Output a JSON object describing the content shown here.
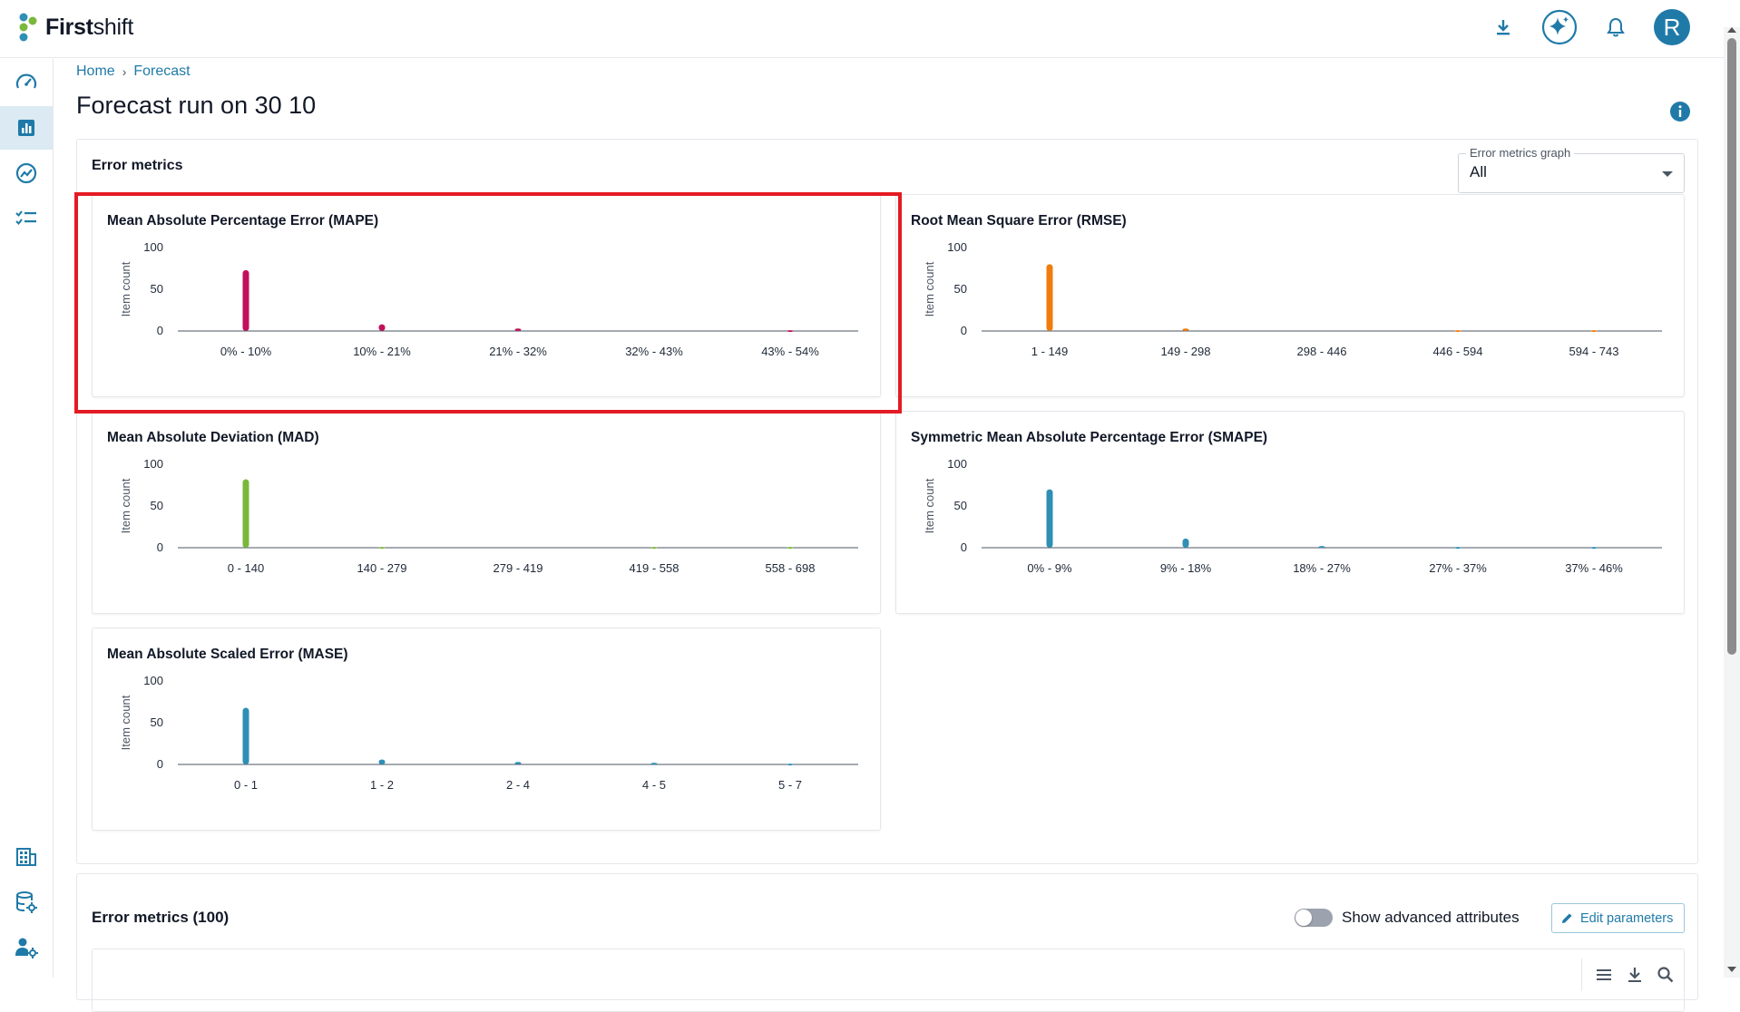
{
  "app": {
    "logo_light": "First",
    "logo_bold": "shift"
  },
  "header": {
    "avatar_initial": "R"
  },
  "breadcrumb": {
    "home": "Home",
    "separator": "›",
    "current": "Forecast"
  },
  "page": {
    "title": "Forecast run on 30 10"
  },
  "metrics_panel": {
    "title": "Error metrics",
    "select": {
      "label": "Error metrics graph",
      "value": "All"
    }
  },
  "table_panel": {
    "title": "Error metrics (100)",
    "toggle_label": "Show advanced attributes",
    "edit_label": "Edit parameters"
  },
  "colors": {
    "accent": "#1f7aa8",
    "highlight": "#e31b23"
  },
  "icons": {
    "top": [
      "download-icon",
      "ai-sparkle-icon",
      "bell-icon"
    ],
    "sidebar": [
      "dashboard-gauge-icon",
      "bar-chart-icon",
      "trend-icon",
      "checklist-icon",
      "building-icon",
      "database-settings-icon",
      "user-settings-icon"
    ],
    "table_tools": [
      "column-menu-icon",
      "table-download-icon",
      "table-search-icon"
    ]
  },
  "chart_data": [
    {
      "type": "bar",
      "title": "Mean Absolute Percentage Error (MAPE)",
      "ylabel": "Item count",
      "xlabel": "",
      "ylim": [
        0,
        100
      ],
      "yticks": [
        0,
        50,
        100
      ],
      "color": "#c0115a",
      "categories": [
        "0% - 10%",
        "10% - 21%",
        "21% - 32%",
        "32% - 43%",
        "43% - 54%"
      ],
      "values": [
        73,
        8,
        3,
        0,
        1
      ]
    },
    {
      "type": "bar",
      "title": "Root Mean Square Error (RMSE)",
      "ylabel": "Item count",
      "xlabel": "",
      "ylim": [
        0,
        100
      ],
      "yticks": [
        0,
        50,
        100
      ],
      "color": "#f07c0e",
      "categories": [
        "1 - 149",
        "149 - 298",
        "298 - 446",
        "446 - 594",
        "594 - 743"
      ],
      "values": [
        80,
        3,
        0,
        1,
        1
      ]
    },
    {
      "type": "bar",
      "title": "Mean Absolute Deviation (MAD)",
      "ylabel": "Item count",
      "xlabel": "",
      "ylim": [
        0,
        100
      ],
      "yticks": [
        0,
        50,
        100
      ],
      "color": "#7ab83b",
      "categories": [
        "0 - 140",
        "140 - 279",
        "279 - 419",
        "419 - 558",
        "558 - 698"
      ],
      "values": [
        82,
        1,
        0,
        1,
        1
      ]
    },
    {
      "type": "bar",
      "title": "Symmetric Mean Absolute Percentage Error (SMAPE)",
      "ylabel": "Item count",
      "xlabel": "",
      "ylim": [
        0,
        100
      ],
      "yticks": [
        0,
        50,
        100
      ],
      "color": "#2f8fb5",
      "categories": [
        "0% - 9%",
        "9% - 18%",
        "18% - 27%",
        "27% - 37%",
        "37% - 46%"
      ],
      "values": [
        70,
        11,
        2,
        1,
        1
      ]
    },
    {
      "type": "bar",
      "title": "Mean Absolute Scaled Error (MASE)",
      "ylabel": "Item count",
      "xlabel": "",
      "ylim": [
        0,
        100
      ],
      "yticks": [
        0,
        50,
        100
      ],
      "color": "#2f8fb5",
      "categories": [
        "0 - 1",
        "1 - 2",
        "2 - 4",
        "4 - 5",
        "5 - 7"
      ],
      "values": [
        68,
        6,
        3,
        2,
        1
      ]
    }
  ]
}
